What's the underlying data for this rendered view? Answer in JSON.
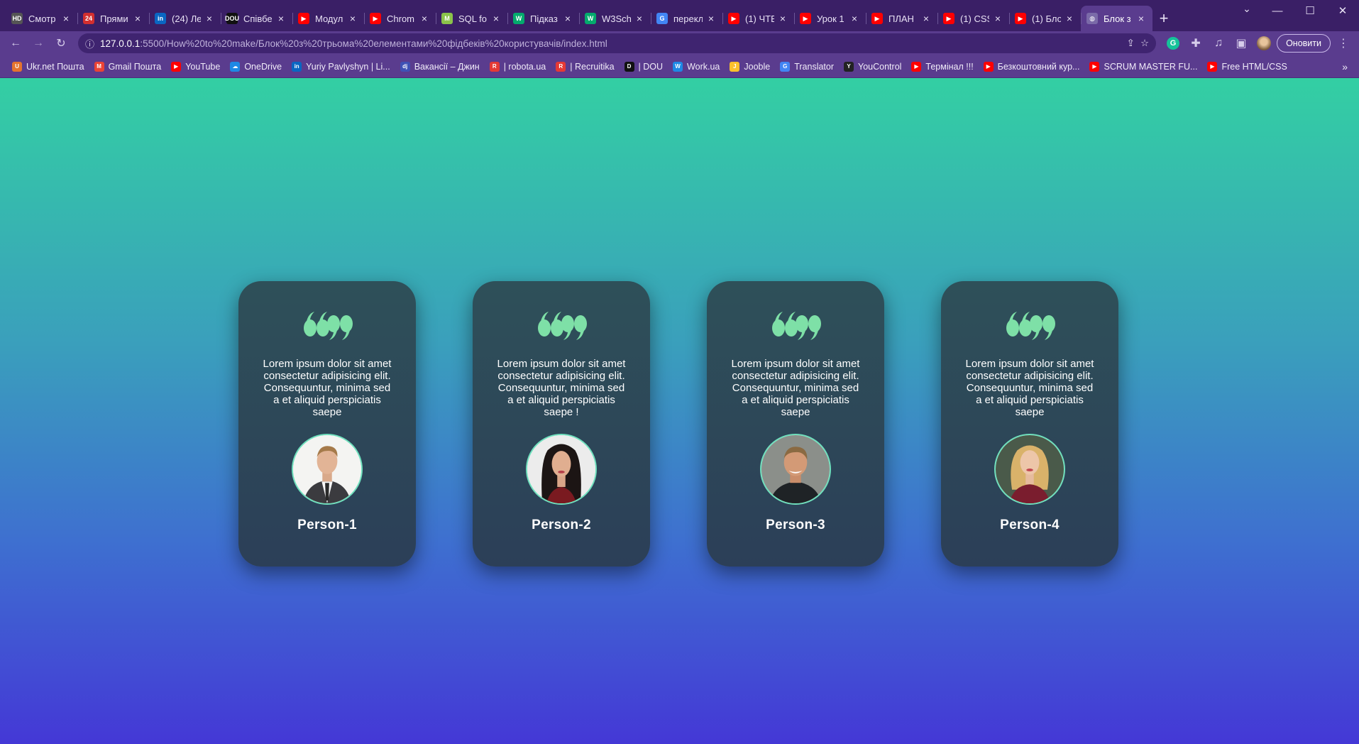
{
  "browser": {
    "tabs": [
      {
        "title": "Смотр",
        "favicon": "hd-icon",
        "color": "#555555",
        "glyph": "HD"
      },
      {
        "title": "Прями",
        "favicon": "24-icon",
        "color": "#d32f2f",
        "glyph": "24"
      },
      {
        "title": "(24) Ле",
        "favicon": "linkedin-icon",
        "color": "#0a66c2",
        "glyph": "in"
      },
      {
        "title": "Співбе",
        "favicon": "dou-icon",
        "color": "#111111",
        "glyph": "DOU"
      },
      {
        "title": "Модул",
        "favicon": "youtube-icon",
        "color": "#ff0000",
        "glyph": "▶"
      },
      {
        "title": "Chrom",
        "favicon": "youtube-icon",
        "color": "#ff0000",
        "glyph": "▶"
      },
      {
        "title": "SQL fo",
        "favicon": "m-icon",
        "color": "#8bc34a",
        "glyph": "M"
      },
      {
        "title": "Підказ",
        "favicon": "w3-icon",
        "color": "#04aa6d",
        "glyph": "W"
      },
      {
        "title": "W3Sch",
        "favicon": "w3-icon",
        "color": "#04aa6d",
        "glyph": "W"
      },
      {
        "title": "перекл",
        "favicon": "google-icon",
        "color": "#4285f4",
        "glyph": "G"
      },
      {
        "title": "(1) ЧТЕ",
        "favicon": "youtube-icon",
        "color": "#ff0000",
        "glyph": "▶"
      },
      {
        "title": "Урок 1",
        "favicon": "youtube-icon",
        "color": "#ff0000",
        "glyph": "▶"
      },
      {
        "title": "ПЛАН",
        "favicon": "youtube-icon",
        "color": "#ff0000",
        "glyph": "▶"
      },
      {
        "title": "(1) CSS",
        "favicon": "youtube-icon",
        "color": "#ff0000",
        "glyph": "▶"
      },
      {
        "title": "(1) Бло",
        "favicon": "youtube-icon",
        "color": "#ff0000",
        "glyph": "▶"
      },
      {
        "title": "Блок з",
        "favicon": "globe-icon",
        "color": "#7a6aa8",
        "glyph": "◍",
        "active": true
      }
    ],
    "close_glyph": "×",
    "new_tab_glyph": "+",
    "url_host": "127.0.0.1",
    "url_path": ":5500/How%20to%20make/Блок%20з%20трьома%20елементами%20фідбеків%20користувачів/index.html",
    "update_label": "Оновити",
    "bookmarks": [
      {
        "label": "Ukr.net Пошта",
        "icon": "ukrnet-icon",
        "color": "#e5732e",
        "glyph": "U"
      },
      {
        "label": "Gmail Пошта",
        "icon": "gmail-icon",
        "color": "#ea4335",
        "glyph": "M"
      },
      {
        "label": "YouTube",
        "icon": "youtube-icon",
        "color": "#ff0000",
        "glyph": "▶"
      },
      {
        "label": "OneDrive",
        "icon": "onedrive-icon",
        "color": "#1e88e5",
        "glyph": "☁"
      },
      {
        "label": "Yuriy Pavlyshyn | Li...",
        "icon": "linkedin-icon",
        "color": "#0a66c2",
        "glyph": "in"
      },
      {
        "label": "Вакансії – Джин",
        "icon": "djinni-icon",
        "color": "#3f51b5",
        "glyph": "dj"
      },
      {
        "label": "| robota.ua",
        "icon": "robota-icon",
        "color": "#e53935",
        "glyph": "R"
      },
      {
        "label": "| Recruitika",
        "icon": "recruitika-icon",
        "color": "#e53935",
        "glyph": "R"
      },
      {
        "label": "| DOU",
        "icon": "dou-icon",
        "color": "#111111",
        "glyph": "D"
      },
      {
        "label": "Work.ua",
        "icon": "workua-icon",
        "color": "#1e88e5",
        "glyph": "W"
      },
      {
        "label": "Jooble",
        "icon": "jooble-icon",
        "color": "#fbc02d",
        "glyph": "J"
      },
      {
        "label": "Translator",
        "icon": "google-icon",
        "color": "#4285f4",
        "glyph": "G"
      },
      {
        "label": "YouControl",
        "icon": "youcontrol-icon",
        "color": "#222222",
        "glyph": "Y"
      },
      {
        "label": "Термінал !!!",
        "icon": "youtube-icon",
        "color": "#ff0000",
        "glyph": "▶"
      },
      {
        "label": "Безкоштовний кур...",
        "icon": "youtube-icon",
        "color": "#ff0000",
        "glyph": "▶"
      },
      {
        "label": "SCRUM MASTER FU...",
        "icon": "youtube-icon",
        "color": "#ff0000",
        "glyph": "▶"
      },
      {
        "label": "Free HTML/CSS",
        "icon": "youtube-icon",
        "color": "#ff0000",
        "glyph": "▶"
      }
    ],
    "bookmarks_more_glyph": "»"
  },
  "page": {
    "quote_color": "#7ee0a7",
    "cards": [
      {
        "text": "Lorem ipsum dolor sit amet consectetur adipisicing elit. Consequuntur, minima sed a et aliquid perspiciatis saepe",
        "name": "Person-1",
        "avatar": "man-suit-portrait"
      },
      {
        "text": "Lorem ipsum dolor sit amet consectetur adipisicing elit. Consequuntur, minima sed a et aliquid perspiciatis saepe !",
        "name": "Person-2",
        "avatar": "woman-dark-hair-portrait"
      },
      {
        "text": "Lorem ipsum dolor sit amet consectetur adipisicing elit. Consequuntur, minima sed a et aliquid perspiciatis saepe",
        "name": "Person-3",
        "avatar": "man-smiling-portrait"
      },
      {
        "text": "Lorem ipsum dolor sit amet consectetur adipisicing elit. Consequuntur, minima sed a et aliquid perspiciatis saepe",
        "name": "Person-4",
        "avatar": "woman-blonde-portrait"
      }
    ]
  }
}
